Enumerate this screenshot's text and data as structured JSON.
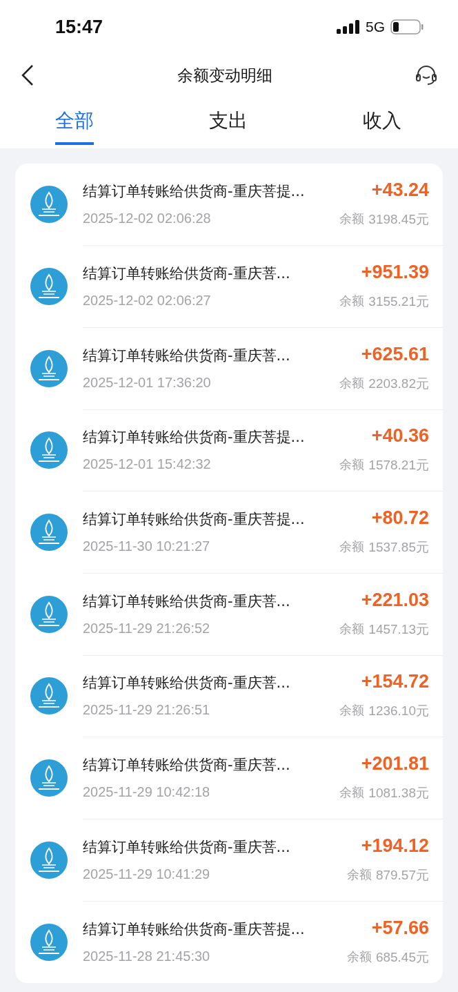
{
  "status_bar": {
    "time": "15:47",
    "network": "5G"
  },
  "header": {
    "title": "余额变动明细"
  },
  "tabs": [
    {
      "label": "全部",
      "selected": true
    },
    {
      "label": "支出",
      "selected": false
    },
    {
      "label": "收入",
      "selected": false
    }
  ],
  "transactions": [
    {
      "title": "结算订单转账给供货商-重庆菩提...",
      "amount": "+43.24",
      "time": "2025-12-02 02:06:28",
      "balance_label": "余额",
      "balance": "3198.45元"
    },
    {
      "title": "结算订单转账给供货商-重庆菩...",
      "amount": "+951.39",
      "time": "2025-12-02 02:06:27",
      "balance_label": "余额",
      "balance": "3155.21元"
    },
    {
      "title": "结算订单转账给供货商-重庆菩...",
      "amount": "+625.61",
      "time": "2025-12-01 17:36:20",
      "balance_label": "余额",
      "balance": "2203.82元"
    },
    {
      "title": "结算订单转账给供货商-重庆菩提...",
      "amount": "+40.36",
      "time": "2025-12-01 15:42:32",
      "balance_label": "余额",
      "balance": "1578.21元"
    },
    {
      "title": "结算订单转账给供货商-重庆菩提...",
      "amount": "+80.72",
      "time": "2025-11-30 10:21:27",
      "balance_label": "余额",
      "balance": "1537.85元"
    },
    {
      "title": "结算订单转账给供货商-重庆菩...",
      "amount": "+221.03",
      "time": "2025-11-29 21:26:52",
      "balance_label": "余额",
      "balance": "1457.13元"
    },
    {
      "title": "结算订单转账给供货商-重庆菩...",
      "amount": "+154.72",
      "time": "2025-11-29 21:26:51",
      "balance_label": "余额",
      "balance": "1236.10元"
    },
    {
      "title": "结算订单转账给供货商-重庆菩...",
      "amount": "+201.81",
      "time": "2025-11-29 10:42:18",
      "balance_label": "余额",
      "balance": "1081.38元"
    },
    {
      "title": "结算订单转账给供货商-重庆菩...",
      "amount": "+194.12",
      "time": "2025-11-29 10:41:29",
      "balance_label": "余额",
      "balance": "879.57元"
    },
    {
      "title": "结算订单转账给供货商-重庆菩提...",
      "amount": "+57.66",
      "time": "2025-11-28 21:45:30",
      "balance_label": "余额",
      "balance": "685.45元"
    }
  ]
}
